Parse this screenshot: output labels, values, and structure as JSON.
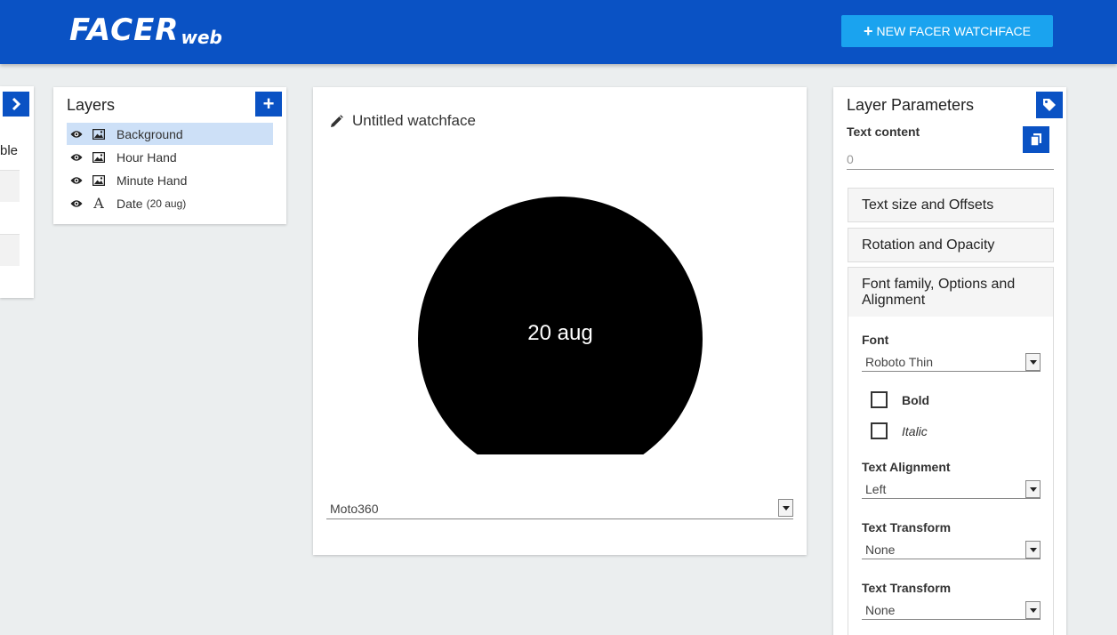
{
  "app": {
    "logo_main": "FACER",
    "logo_sub": "web"
  },
  "header": {
    "new_button_label": "NEW FACER WATCHFACE",
    "new_button_icon": "plus-icon"
  },
  "left_panel": {
    "fragment_text": "ble",
    "toggle_icon": "chevron-right-icon"
  },
  "layers": {
    "title": "Layers",
    "add_icon": "plus-icon",
    "items": [
      {
        "label": "Background",
        "suffix": "",
        "type_icon": "image-icon",
        "active": true
      },
      {
        "label": "Hour Hand",
        "suffix": "",
        "type_icon": "image-icon",
        "active": false
      },
      {
        "label": "Minute Hand",
        "suffix": "",
        "type_icon": "image-icon",
        "active": false
      },
      {
        "label": "Date",
        "suffix": "(20 aug)",
        "type_icon": "text-icon",
        "type_glyph": "A",
        "active": false
      }
    ]
  },
  "canvas": {
    "title": "Untitled watchface",
    "watch_text": "20 aug",
    "device": "Moto360"
  },
  "params": {
    "title": "Layer Parameters",
    "text_content_label": "Text content",
    "text_content_value": "0",
    "sections": {
      "size_offsets": "Text size and Offsets",
      "rotation_opacity": "Rotation and Opacity",
      "font_options": "Font family, Options and Alignment"
    },
    "font_label": "Font",
    "font_value": "Roboto Thin",
    "bold_label": "Bold",
    "italic_label": "Italic",
    "alignment_label": "Text Alignment",
    "alignment_value": "Left",
    "transform_label_1": "Text Transform",
    "transform_value_1": "None",
    "transform_label_2": "Text Transform",
    "transform_value_2": "None"
  },
  "colors": {
    "primary": "#0a52c4",
    "accent": "#1aa3ef",
    "selected_row": "#cde0f7",
    "background": "#ebeeef"
  }
}
